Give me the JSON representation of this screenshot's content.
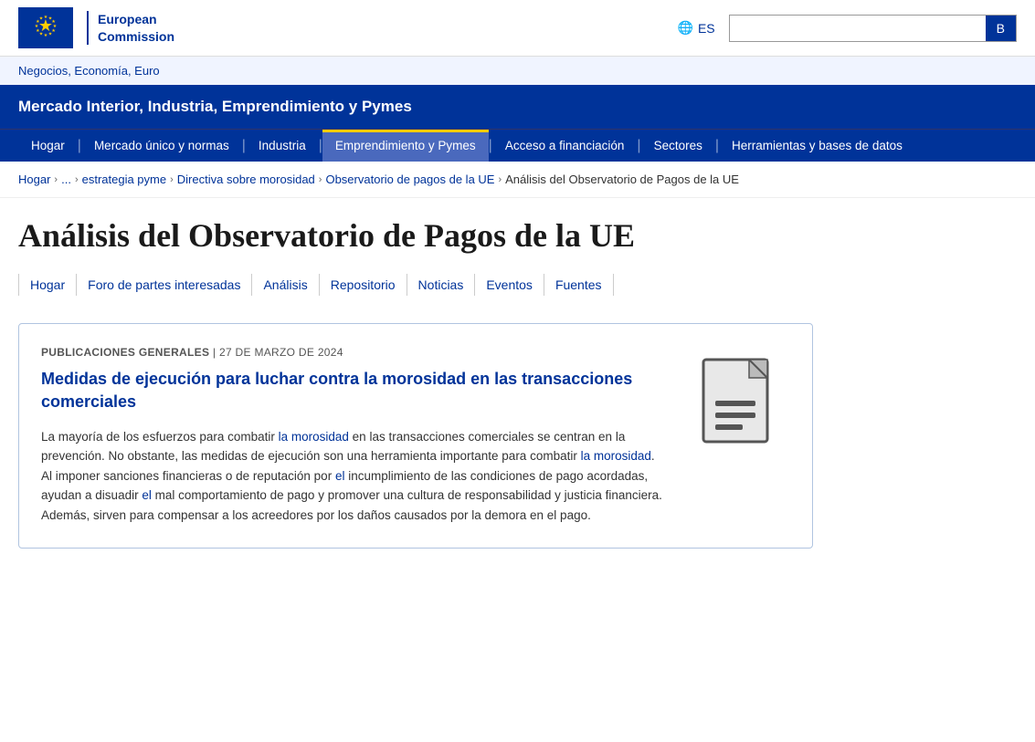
{
  "header": {
    "commission_line1": "European",
    "commission_line2": "Commission",
    "lang_code": "ES",
    "search_placeholder": "",
    "search_button": "B"
  },
  "top_breadcrumb": {
    "label": "Negocios, Economía, Euro"
  },
  "site_title": "Mercado Interior, Industria, Emprendimiento y Pymes",
  "main_nav": {
    "items": [
      {
        "label": "Hogar",
        "active": false
      },
      {
        "label": "Mercado único y normas",
        "active": false
      },
      {
        "label": "Industria",
        "active": false
      },
      {
        "label": "Emprendimiento y Pymes",
        "active": true
      },
      {
        "label": "Acceso a financiación",
        "active": false
      },
      {
        "label": "Sectores",
        "active": false
      },
      {
        "label": "Herramientas y bases de datos",
        "active": false
      }
    ]
  },
  "breadcrumb": {
    "items": [
      {
        "label": "Hogar",
        "link": true
      },
      {
        "label": "...",
        "link": true
      },
      {
        "label": "estrategia pyme",
        "link": true
      },
      {
        "label": "Directiva sobre morosidad",
        "link": true
      },
      {
        "label": "Observatorio de pagos de la UE",
        "link": true
      },
      {
        "label": "Análisis del Observatorio de Pagos de la UE",
        "link": false
      }
    ]
  },
  "page_title": "Análisis del Observatorio de Pagos de la UE",
  "sub_nav": {
    "items": [
      "Hogar",
      "Foro de partes interesadas",
      "Análisis",
      "Repositorio",
      "Noticias",
      "Eventos",
      "Fuentes"
    ]
  },
  "card": {
    "category": "PUBLICACIONES GENERALES",
    "separator": "|",
    "date": "27 de marzo de 2024",
    "title": "Medidas de ejecución para luchar contra la morosidad en las transacciones comerciales",
    "body_parts": [
      "La mayoría de los esfuerzos para combatir la ",
      "morosidad",
      " en las transacciones comerciales se centran en la prevención. No obstante, las medidas de ejecución son una herramienta importante para combatir ",
      "la morosidad",
      ". Al imponer sanciones financieras o de reputación por ",
      "el",
      " incumplimiento de las condiciones de pago acordadas, ayudan a disuadir ",
      "el",
      " mal comportamiento de pago y promover una cultura de responsabilidad y justicia financiera. Además, sirven para compensar a los acreedores por los daños causados por la demora en el pago."
    ]
  },
  "colors": {
    "primary_blue": "#003399",
    "accent_yellow": "#ffcc00",
    "light_blue_bg": "#f0f4ff",
    "card_border": "#b0c4e0",
    "highlight_blue": "#003399"
  }
}
